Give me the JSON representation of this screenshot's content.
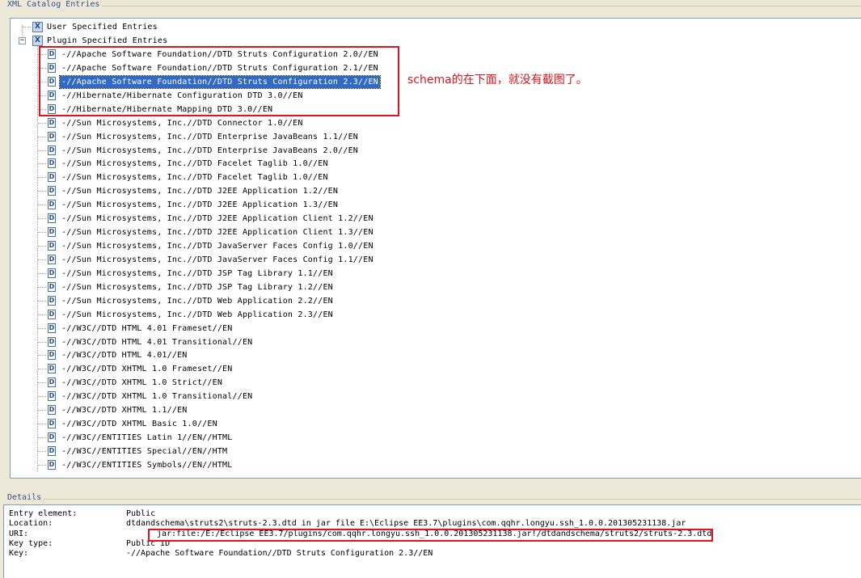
{
  "catalog": {
    "group_title": "XML Catalog Entries",
    "roots": [
      {
        "label": "User Specified Entries",
        "icon": "xml-catalog-icon",
        "expanded": false
      },
      {
        "label": "Plugin Specified Entries",
        "icon": "xml-catalog-icon",
        "expanded": true
      }
    ],
    "entries": [
      "-//Apache Software Foundation//DTD Struts Configuration 2.0//EN",
      "-//Apache Software Foundation//DTD Struts Configuration 2.1//EN",
      "-//Apache Software Foundation//DTD Struts Configuration 2.3//EN",
      "-//Hibernate/Hibernate Configuration DTD 3.0//EN",
      "-//Hibernate/Hibernate Mapping DTD 3.0//EN",
      "-//Sun Microsystems, Inc.//DTD Connector 1.0//EN",
      "-//Sun Microsystems, Inc.//DTD Enterprise JavaBeans 1.1//EN",
      "-//Sun Microsystems, Inc.//DTD Enterprise JavaBeans 2.0//EN",
      "-//Sun Microsystems, Inc.//DTD Facelet Taglib 1.0//EN",
      "-//Sun Microsystems, Inc.//DTD Facelet Taglib 1.0//EN",
      "-//Sun Microsystems, Inc.//DTD J2EE Application 1.2//EN",
      "-//Sun Microsystems, Inc.//DTD J2EE Application 1.3//EN",
      "-//Sun Microsystems, Inc.//DTD J2EE Application Client 1.2//EN",
      "-//Sun Microsystems, Inc.//DTD J2EE Application Client 1.3//EN",
      "-//Sun Microsystems, Inc.//DTD JavaServer Faces Config 1.0//EN",
      "-//Sun Microsystems, Inc.//DTD JavaServer Faces Config 1.1//EN",
      "-//Sun Microsystems, Inc.//DTD JSP Tag Library 1.1//EN",
      "-//Sun Microsystems, Inc.//DTD JSP Tag Library 1.2//EN",
      "-//Sun Microsystems, Inc.//DTD Web Application 2.2//EN",
      "-//Sun Microsystems, Inc.//DTD Web Application 2.3//EN",
      "-//W3C//DTD HTML 4.01 Frameset//EN",
      "-//W3C//DTD HTML 4.01 Transitional//EN",
      "-//W3C//DTD HTML 4.01//EN",
      "-//W3C//DTD XHTML 1.0 Frameset//EN",
      "-//W3C//DTD XHTML 1.0 Strict//EN",
      "-//W3C//DTD XHTML 1.0 Transitional//EN",
      "-//W3C//DTD XHTML 1.1//EN",
      "-//W3C//DTD XHTML Basic 1.0//EN",
      "-//W3C//ENTITIES Latin 1//EN//HTML",
      "-//W3C//ENTITIES Special//EN//HTM",
      "-//W3C//ENTITIES Symbols//EN//HTML"
    ],
    "entry_icon_glyph": "D",
    "root_icon_glyph": "X",
    "selected_index": 2
  },
  "annotation": {
    "text": "schema的在下面，就没有截图了。",
    "color": "#e0141e"
  },
  "details": {
    "group_title": "Details",
    "rows": [
      {
        "label": "Entry element:",
        "value": "Public"
      },
      {
        "label": "Location:",
        "value": "dtdandschema\\struts2\\struts-2.3.dtd in jar file E:\\Eclipse EE3.7\\plugins\\com.qqhr.longyu.ssh_1.0.0.201305231138.jar"
      },
      {
        "label": "URI:",
        "value": "jar:file:/E:/Eclipse EE3.7/plugins/com.qqhr.longyu.ssh_1.0.0.201305231138.jar!/dtdandschema/struts2/struts-2.3.dtd"
      },
      {
        "label": "Key type:",
        "value": "Public ID"
      },
      {
        "label": "Key:",
        "value": "-//Apache Software Foundation//DTD Struts Configuration 2.3//EN"
      }
    ]
  },
  "colors": {
    "selection": "#316ac5",
    "highlight_box": "#e0141e",
    "group_title": "#3a4f8c"
  }
}
